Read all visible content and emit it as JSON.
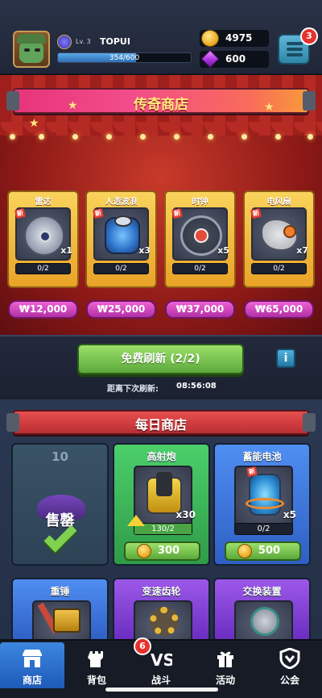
{
  "player": {
    "level": "Lv. 3",
    "name": "TOPUI",
    "xp_text": "354/600",
    "xp_fraction": 0.59
  },
  "currency": {
    "gold": "4975",
    "gems": "600"
  },
  "menu": {
    "badge": "3"
  },
  "legend_shop": {
    "title": "传奇商店",
    "items": [
      {
        "name": "雷达",
        "tag": "新",
        "qty": "x1",
        "progress": "0/2",
        "price": "₩12,000",
        "icon": "radar-icon"
      },
      {
        "name": "人造波浪",
        "tag": "新",
        "qty": "x3",
        "progress": "0/2",
        "price": "₩25,000",
        "icon": "wave-generator-icon"
      },
      {
        "name": "时钟",
        "tag": "新",
        "qty": "x5",
        "progress": "0/2",
        "price": "₩37,000",
        "icon": "clock-icon"
      },
      {
        "name": "电风扇",
        "tag": "新",
        "qty": "x7",
        "progress": "0/2",
        "price": "₩65,000",
        "icon": "electric-fan-icon"
      }
    ]
  },
  "refresh": {
    "button": "免费刷新 (2/2)",
    "info": "i",
    "countdown_label": "距离下次刷新:",
    "countdown": "08:56:08"
  },
  "daily_shop": {
    "title": "每日商店",
    "sold": {
      "count": "10",
      "label": "售罄"
    },
    "items": [
      {
        "name": "高射炮",
        "qty": "x30",
        "progress": "130/2",
        "progress_fraction": 1.0,
        "price": "300",
        "icon": "anti-aircraft-gun-icon"
      },
      {
        "name": "蓄能电池",
        "tag": "新",
        "qty": "x5",
        "progress": "0/2",
        "progress_fraction": 0.0,
        "price": "500",
        "icon": "energy-battery-icon"
      },
      {
        "name": "重锤",
        "icon": "hammer-icon"
      },
      {
        "name": "变速齿轮",
        "icon": "gear-icon"
      },
      {
        "name": "交换装置",
        "icon": "exchange-device-icon"
      }
    ]
  },
  "nav": {
    "items": [
      {
        "label": "商店",
        "icon": "shop-icon",
        "active": true
      },
      {
        "label": "背包",
        "icon": "backpack-icon",
        "badge": "6"
      },
      {
        "label": "战斗",
        "icon": "vs-icon"
      },
      {
        "label": "活动",
        "icon": "gift-icon"
      },
      {
        "label": "公会",
        "icon": "guild-shield-icon"
      }
    ]
  }
}
